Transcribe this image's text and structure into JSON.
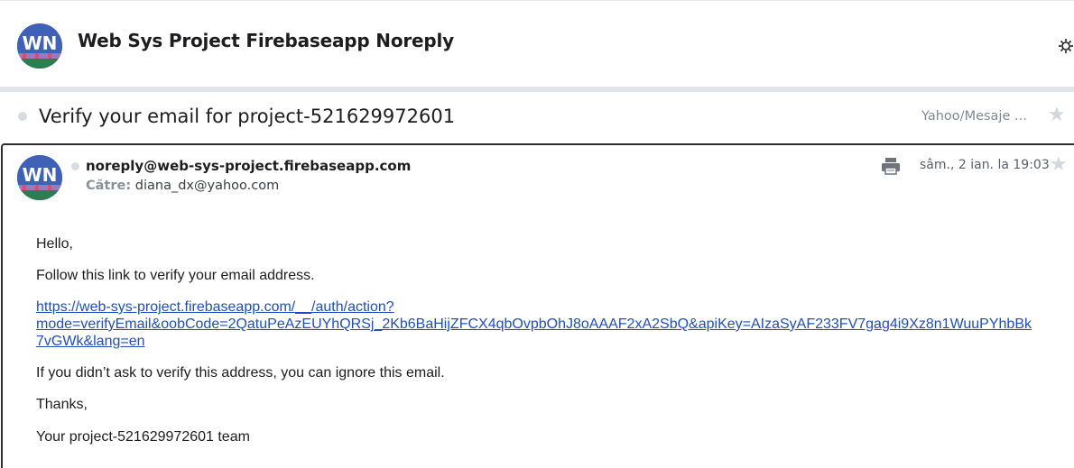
{
  "thread": {
    "title": "Web Sys Project Firebaseapp Noreply",
    "avatar_initials": "WN"
  },
  "subject": {
    "text": "Verify your email for project-521629972601",
    "folder": "Yahoo/Mesaje ..."
  },
  "message": {
    "from": "noreply@web-sys-project.firebaseapp.com",
    "to_label": "Către:",
    "to_value": "diana_dx@yahoo.com",
    "date": "sâm., 2 ian. la 19:03",
    "body": {
      "greeting": "Hello,",
      "instruction": "Follow this link to verify your email address.",
      "link_line1": "https://web-sys-project.firebaseapp.com/__/auth/action?",
      "link_line2": "mode=verifyEmail&oobCode=2QatuPeAzEUYhQRSj_2Kb6BaHijZFCX4qbOvpbOhJ8oAAAF2xA2SbQ&apiKey=AIzaSyAF233FV7gag4i9Xz8n1WuuPYhbBk",
      "link_line3": "7vGWk&lang=en",
      "ignore_note": "If you didn’t ask to verify this address, you can ignore this email.",
      "thanks": "Thanks,",
      "signature": "Your project-521629972601 team"
    }
  },
  "icons": {
    "settings": "settings-icon",
    "star": "star-icon",
    "print": "print-icon"
  },
  "colors": {
    "link": "#1f4fbf",
    "avatar_bg": "#3f62b8",
    "muted": "#828891"
  }
}
